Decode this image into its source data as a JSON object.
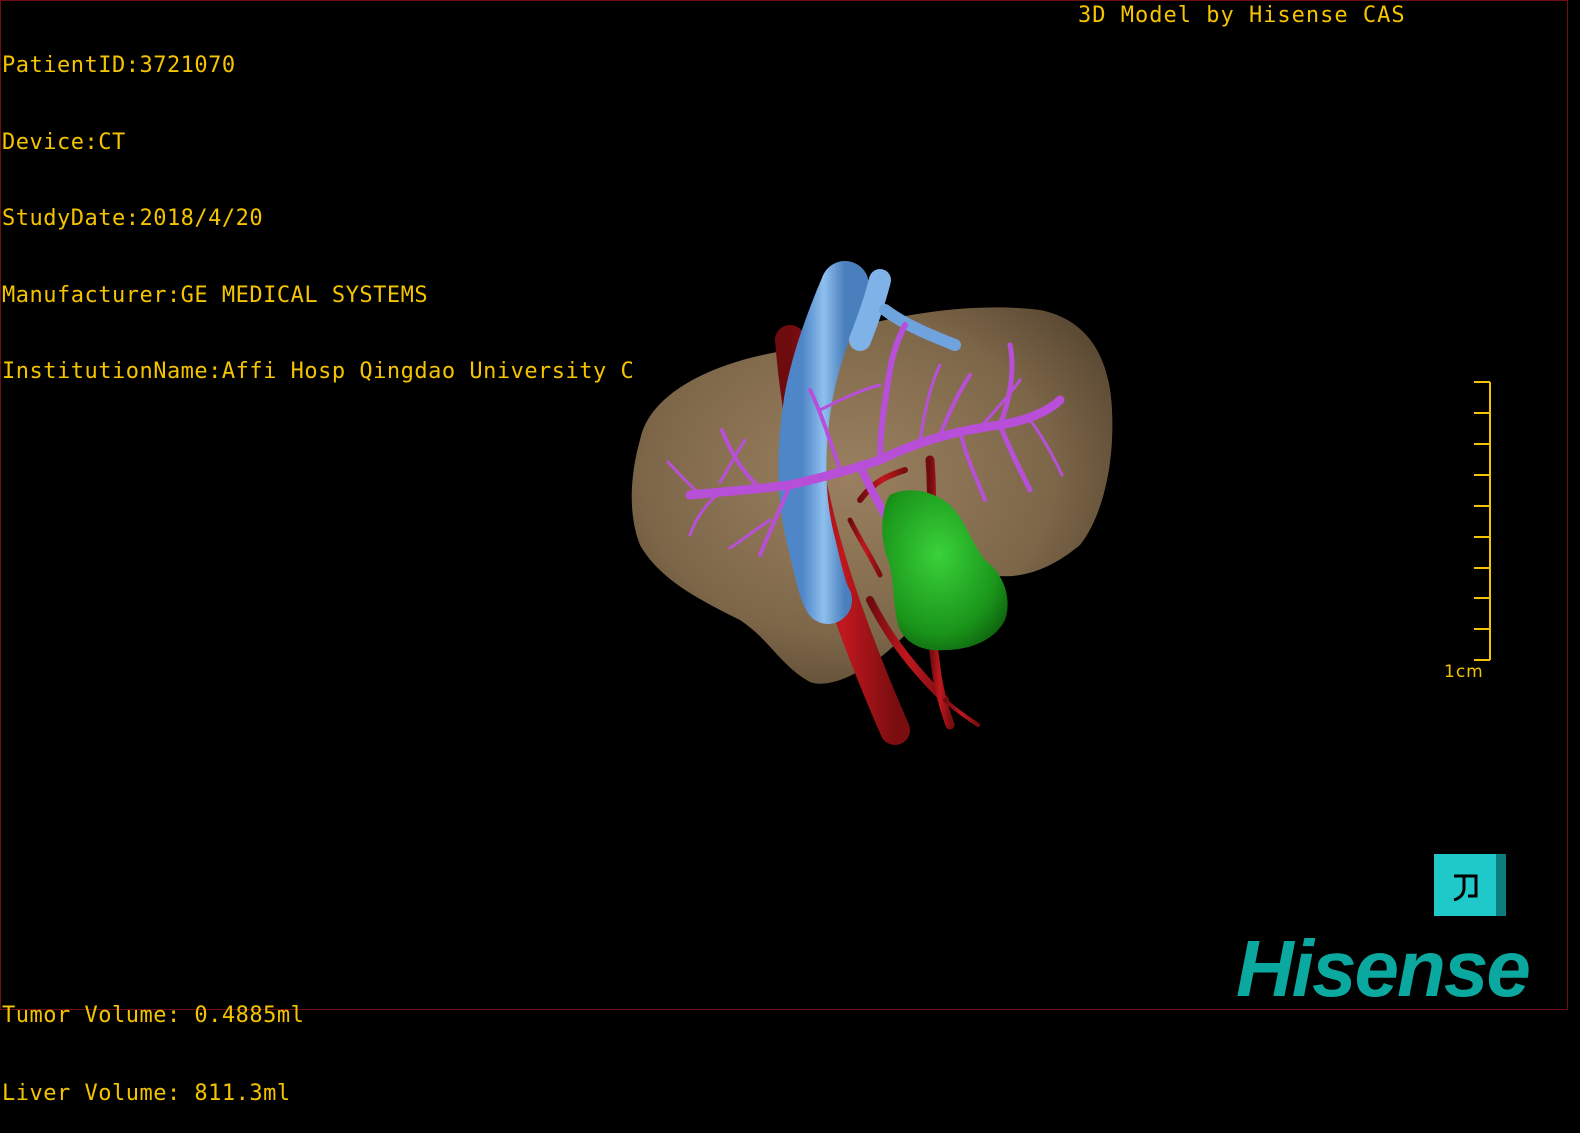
{
  "overlay": {
    "patient_id": "PatientID:3721070",
    "device": "Device:CT",
    "study_date": "StudyDate:2018/4/20",
    "manufacturer": "Manufacturer:GE MEDICAL SYSTEMS",
    "institution": "InstitutionName:Affi Hosp Qingdao University C",
    "credit": "3D Model by Hisense CAS",
    "tumor_volume": "Tumor Volume: 0.4885ml",
    "liver_volume": "Liver Volume: 811.3ml"
  },
  "scale_bar": {
    "label": "1cm"
  },
  "brand": {
    "name": "Hisense"
  },
  "colors": {
    "text": "#f5c400",
    "liver": "#8a7150",
    "hepatic_vein": "#b84fd8",
    "portal_vein": "#6fa8e0",
    "artery": "#a0151a",
    "tumor": "#1e9b1e",
    "brand": "#0aa89e",
    "logo_box": "#1fc9c9"
  },
  "icons": [
    "logo-icon"
  ]
}
